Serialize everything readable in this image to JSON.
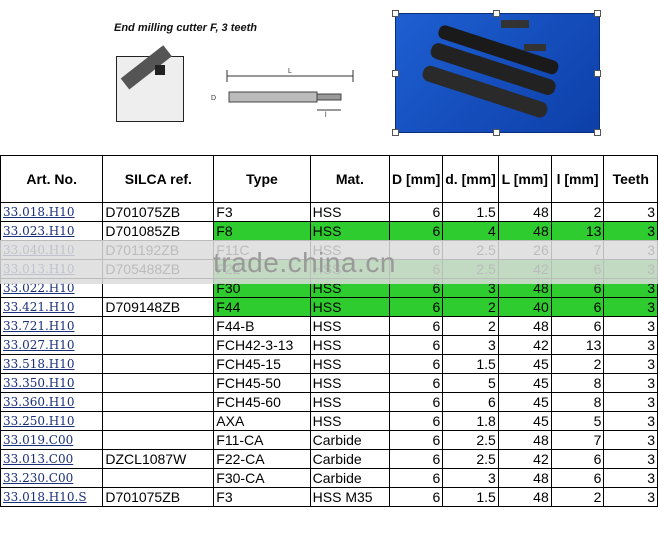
{
  "caption": "End milling cutter F, 3 teeth",
  "drawing_labels": {
    "L": "L",
    "l": "l",
    "D": "D"
  },
  "watermark": "trade.china.cn",
  "colors": {
    "highlight": "#2ecc2e",
    "photo_bg": "#1e5fd2"
  },
  "table": {
    "headers": [
      "Art. No.",
      "SILCA ref.",
      "Type",
      "Mat.",
      "D [mm]",
      "d. [mm]",
      "L [mm]",
      "l [mm]",
      "Teeth"
    ],
    "rows": [
      {
        "art": "33.018.H10",
        "silca": "D701075ZB",
        "type": "F3",
        "mat": "HSS",
        "D": "6",
        "d": "1.5",
        "L": "48",
        "l": "2",
        "teeth": "3",
        "hl": false
      },
      {
        "art": "33.023.H10",
        "silca": "D701085ZB",
        "type": "F8",
        "mat": "HSS",
        "D": "6",
        "d": "4",
        "L": "48",
        "l": "13",
        "teeth": "3",
        "hl": true
      },
      {
        "art": "33.040.H10",
        "silca": "D701192ZB",
        "type": "F11C",
        "mat": "HSS",
        "D": "6",
        "d": "2.5",
        "L": "26",
        "l": "7",
        "teeth": "3",
        "hl": false
      },
      {
        "art": "33.013.H10",
        "silca": "D705488ZB",
        "type": "F22",
        "mat": "HSS",
        "D": "6",
        "d": "2.5",
        "L": "42",
        "l": "6",
        "teeth": "3",
        "hl": true
      },
      {
        "art": "33.022.H10",
        "silca": "",
        "type": "F30",
        "mat": "HSS",
        "D": "6",
        "d": "3",
        "L": "48",
        "l": "6",
        "teeth": "3",
        "hl": true
      },
      {
        "art": "33.421.H10",
        "silca": "D709148ZB",
        "type": "F44",
        "mat": "HSS",
        "D": "6",
        "d": "2",
        "L": "40",
        "l": "6",
        "teeth": "3",
        "hl": true
      },
      {
        "art": "33.721.H10",
        "silca": "",
        "type": "F44-B",
        "mat": "HSS",
        "D": "6",
        "d": "2",
        "L": "48",
        "l": "6",
        "teeth": "3",
        "hl": false
      },
      {
        "art": "33.027.H10",
        "silca": "",
        "type": "FCH42-3-13",
        "mat": "HSS",
        "D": "6",
        "d": "3",
        "L": "42",
        "l": "13",
        "teeth": "3",
        "hl": false
      },
      {
        "art": "33.518.H10",
        "silca": "",
        "type": "FCH45-15",
        "mat": "HSS",
        "D": "6",
        "d": "1.5",
        "L": "45",
        "l": "2",
        "teeth": "3",
        "hl": false
      },
      {
        "art": "33.350.H10",
        "silca": "",
        "type": "FCH45-50",
        "mat": "HSS",
        "D": "6",
        "d": "5",
        "L": "45",
        "l": "8",
        "teeth": "3",
        "hl": false
      },
      {
        "art": "33.360.H10",
        "silca": "",
        "type": "FCH45-60",
        "mat": "HSS",
        "D": "6",
        "d": "6",
        "L": "45",
        "l": "8",
        "teeth": "3",
        "hl": false
      },
      {
        "art": "33.250.H10",
        "silca": "",
        "type": "AXA",
        "mat": "HSS",
        "D": "6",
        "d": "1.8",
        "L": "45",
        "l": "5",
        "teeth": "3",
        "hl": false
      },
      {
        "art": "33.019.C00",
        "silca": "",
        "type": "F11-CA",
        "mat": "Carbide",
        "D": "6",
        "d": "2.5",
        "L": "48",
        "l": "7",
        "teeth": "3",
        "hl": false
      },
      {
        "art": "33.013.C00",
        "silca": "DZCL1087W",
        "type": "F22-CA",
        "mat": "Carbide",
        "D": "6",
        "d": "2.5",
        "L": "42",
        "l": "6",
        "teeth": "3",
        "hl": false
      },
      {
        "art": "33.230.C00",
        "silca": "",
        "type": "F30-CA",
        "mat": "Carbide",
        "D": "6",
        "d": "3",
        "L": "48",
        "l": "6",
        "teeth": "3",
        "hl": false
      },
      {
        "art": "33.018.H10.S",
        "silca": "D701075ZB",
        "type": "F3",
        "mat": "HSS M35",
        "D": "6",
        "d": "1.5",
        "L": "48",
        "l": "2",
        "teeth": "3",
        "hl": false
      }
    ]
  }
}
